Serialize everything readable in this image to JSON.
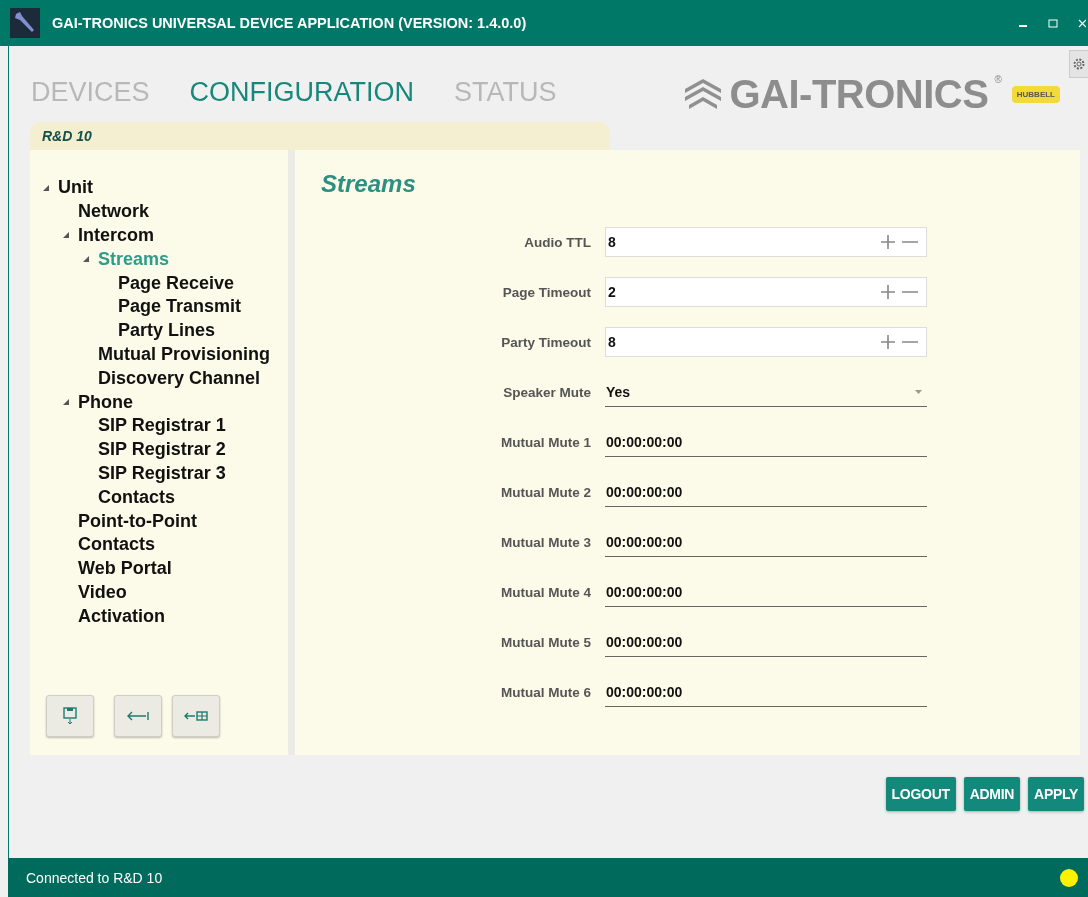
{
  "window": {
    "title": "GAI-TRONICS UNIVERSAL DEVICE APPLICATION (VERSION: 1.4.0.0)"
  },
  "tabs": [
    {
      "label": "DEVICES",
      "selected": false
    },
    {
      "label": "CONFIGURATION",
      "selected": true
    },
    {
      "label": "STATUS",
      "selected": false
    }
  ],
  "logo": {
    "text": "GAI-TRONICS",
    "mark": "®",
    "badge": "HUBBELL"
  },
  "device_tab": {
    "label": "R&D 10"
  },
  "tree": [
    {
      "label": "Unit",
      "expanded": true,
      "selected": false,
      "children": [
        {
          "label": "Network",
          "selected": false
        },
        {
          "label": "Intercom",
          "expanded": true,
          "selected": false,
          "children": [
            {
              "label": "Streams",
              "expanded": true,
              "selected": true,
              "children": [
                {
                  "label": "Page Receive",
                  "selected": false
                },
                {
                  "label": "Page Transmit",
                  "selected": false
                },
                {
                  "label": "Party Lines",
                  "selected": false
                }
              ]
            },
            {
              "label": "Mutual Provisioning",
              "selected": false
            },
            {
              "label": "Discovery Channel",
              "selected": false
            }
          ]
        },
        {
          "label": "Phone",
          "expanded": true,
          "selected": false,
          "children": [
            {
              "label": "SIP Registrar 1",
              "selected": false
            },
            {
              "label": "SIP Registrar 2",
              "selected": false
            },
            {
              "label": "SIP Registrar 3",
              "selected": false
            },
            {
              "label": "Contacts",
              "selected": false
            }
          ]
        },
        {
          "label": "Point-to-Point",
          "selected": false
        },
        {
          "label": "Contacts",
          "selected": false
        },
        {
          "label": "Web Portal",
          "selected": false
        },
        {
          "label": "Video",
          "selected": false
        },
        {
          "label": "Activation",
          "selected": false
        }
      ]
    }
  ],
  "panel": {
    "title": "Streams",
    "fields": [
      {
        "kind": "spin",
        "label": "Audio TTL",
        "value": "8"
      },
      {
        "kind": "spin",
        "label": "Page Timeout",
        "value": "2"
      },
      {
        "kind": "spin",
        "label": "Party Timeout",
        "value": "8"
      },
      {
        "kind": "select",
        "label": "Speaker Mute",
        "value": "Yes"
      },
      {
        "kind": "text",
        "label": "Mutual Mute 1",
        "value": "00:00:00:00"
      },
      {
        "kind": "text",
        "label": "Mutual Mute 2",
        "value": "00:00:00:00"
      },
      {
        "kind": "text",
        "label": "Mutual Mute 3",
        "value": "00:00:00:00"
      },
      {
        "kind": "text",
        "label": "Mutual Mute 4",
        "value": "00:00:00:00"
      },
      {
        "kind": "text",
        "label": "Mutual Mute 5",
        "value": "00:00:00:00"
      },
      {
        "kind": "text",
        "label": "Mutual Mute 6",
        "value": "00:00:00:00"
      }
    ]
  },
  "tool_buttons": [
    {
      "kind": "save"
    },
    {
      "kind": "back"
    },
    {
      "kind": "back-grid"
    }
  ],
  "buttons": [
    "LOGOUT",
    "ADMIN",
    "APPLY"
  ],
  "status_bar": {
    "text": "Connected to R&D 10"
  }
}
